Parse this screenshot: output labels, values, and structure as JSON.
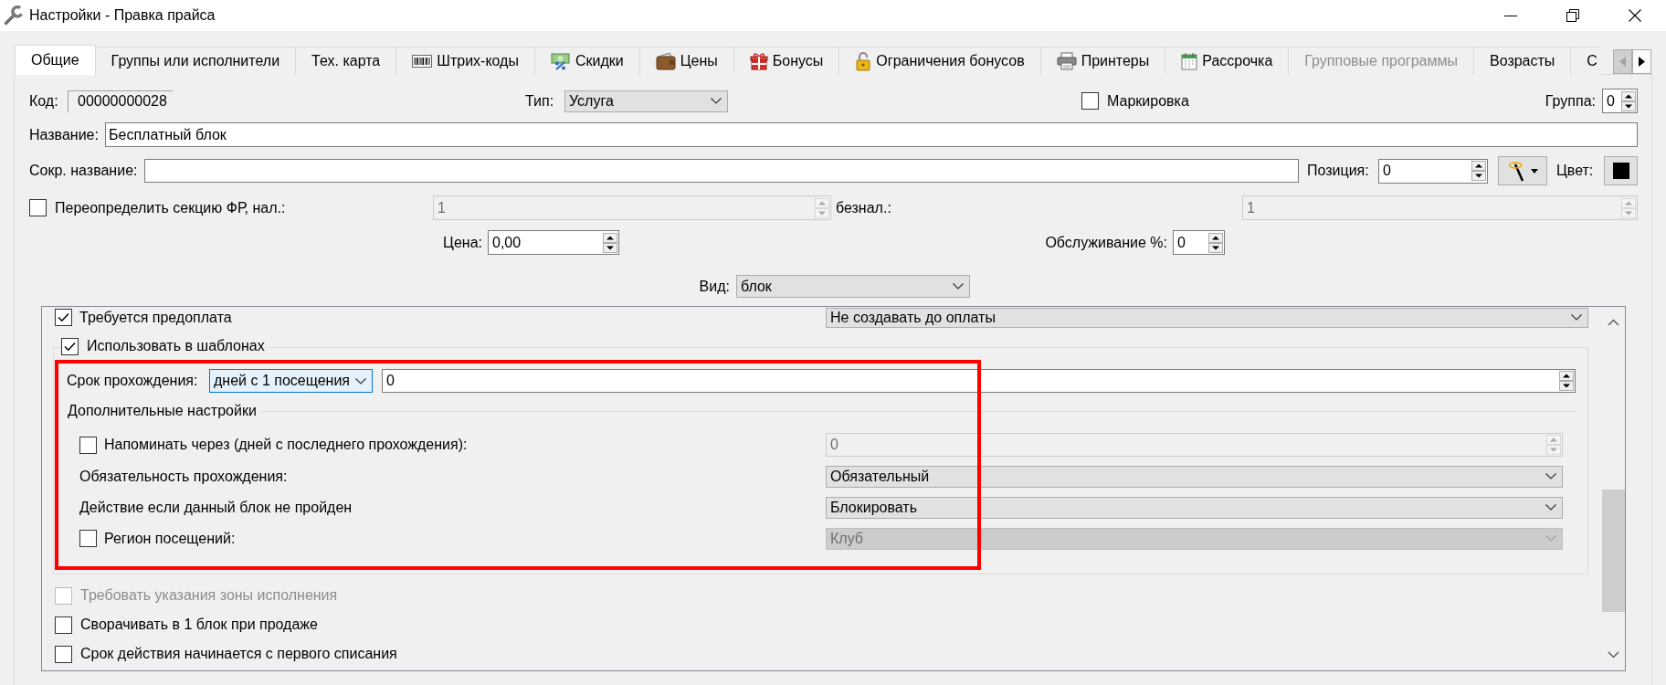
{
  "window": {
    "title": "Настройки - Правка прайса"
  },
  "tabs": [
    {
      "label": "Общие",
      "selected": true,
      "disabled": false
    },
    {
      "label": "Группы или исполнители",
      "selected": false,
      "disabled": false
    },
    {
      "label": "Тех. карта",
      "selected": false,
      "disabled": false
    },
    {
      "label": "Штрих-коды",
      "selected": false,
      "disabled": false
    },
    {
      "label": "Скидки",
      "selected": false,
      "disabled": false
    },
    {
      "label": "Цены",
      "selected": false,
      "disabled": false
    },
    {
      "label": "Бонусы",
      "selected": false,
      "disabled": false
    },
    {
      "label": "Ограничения бонусов",
      "selected": false,
      "disabled": false
    },
    {
      "label": "Принтеры",
      "selected": false,
      "disabled": false
    },
    {
      "label": "Рассрочка",
      "selected": false,
      "disabled": false
    },
    {
      "label": "Групповые программы",
      "selected": false,
      "disabled": true
    },
    {
      "label": "Возрасты",
      "selected": false,
      "disabled": false
    },
    {
      "label": "С",
      "selected": false,
      "disabled": false
    }
  ],
  "form": {
    "code": {
      "label": "Код:",
      "value": "00000000028"
    },
    "type": {
      "label": "Тип:",
      "value": "Услуга"
    },
    "marking": {
      "label": "Маркировка",
      "checked": false
    },
    "group": {
      "label": "Группа:",
      "value": "0"
    },
    "name": {
      "label": "Название:",
      "value": "Бесплатный блок"
    },
    "short_name": {
      "label": "Сокр. название:"
    },
    "position": {
      "label": "Позиция:",
      "value": "0"
    },
    "color_field": {
      "label": "Цвет:",
      "color": "#000000"
    },
    "override_section": {
      "label": "Переопределить секцию ФР, нал.:",
      "checked": false,
      "field": {
        "value": "1",
        "disabled": true
      }
    },
    "cashless": {
      "label": "безнал.:",
      "field": {
        "value": "1",
        "disabled": true
      }
    },
    "price": {
      "label": "Цена:",
      "value": "0,00"
    },
    "service": {
      "label": "Обслуживание %:",
      "value": "0"
    },
    "view": {
      "label": "Вид:",
      "value": "блок"
    }
  },
  "details": {
    "prepayment": {
      "label": "Требуется предоплата",
      "checked": true,
      "value": "Не создавать до оплаты"
    },
    "templates": {
      "label": "Использовать в шаблонах",
      "checked": true,
      "duration": {
        "label": "Срок прохождения:",
        "unit": "дней с 1 посещения",
        "focused": true,
        "value": "0"
      },
      "extra": {
        "title": "Дополнительные настройки",
        "rows": [
          {
            "kind": "check-spin",
            "label": "Напоминать через (дней с последнего прохождения):",
            "checked": false,
            "value": "0",
            "disabled": true
          },
          {
            "kind": "select",
            "label": "Обязательность прохождения:",
            "value": "Обязательный",
            "disabled": false
          },
          {
            "kind": "select",
            "label": "Действие если данный блок не пройден",
            "value": "Блокировать",
            "disabled": false
          },
          {
            "kind": "check-select",
            "label": "Регион посещений:",
            "checked": false,
            "value": "Клуб",
            "disabled": true
          }
        ]
      }
    },
    "options": [
      {
        "label": "Требовать указания зоны исполнения",
        "checked": false,
        "disabled": true
      },
      {
        "label": "Сворачивать в 1 блок при продаже",
        "checked": false,
        "disabled": false
      },
      {
        "label": "Срок действия начинается с первого списания",
        "checked": false,
        "disabled": false
      }
    ]
  }
}
